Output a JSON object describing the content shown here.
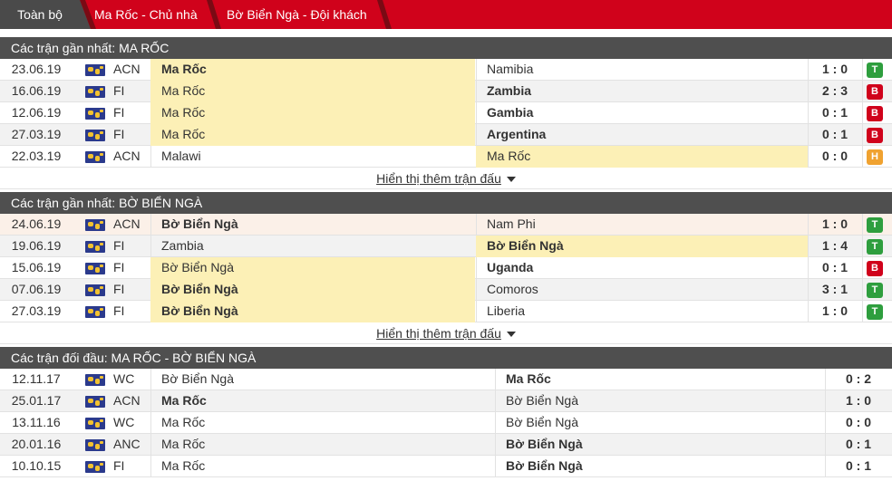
{
  "tabs": [
    {
      "label": "Toàn bộ",
      "active": true
    },
    {
      "label": "Ma Rốc - Chủ nhà",
      "active": false
    },
    {
      "label": "Bờ Biển Ngà - Đội khách",
      "active": false
    }
  ],
  "colors": {
    "tab_bar": "#d0021b",
    "header": "#4f4f4f",
    "win": "#2e9e3e",
    "loss": "#d0021b",
    "draw": "#f0a230",
    "highlight": "#fcf0b6"
  },
  "sections": [
    {
      "title": "Các trận gần nhất: MA RỐC",
      "more": "Hiển thị thêm trận đấu",
      "rows": [
        {
          "date": "23.06.19",
          "comp": "ACN",
          "home": "Ma Rốc",
          "away": "Namibia",
          "score": "1 : 0",
          "result": "T",
          "home_bold": true,
          "away_bold": false,
          "home_hl": true,
          "away_hl": false,
          "row_hl": false
        },
        {
          "date": "16.06.19",
          "comp": "FI",
          "home": "Ma Rốc",
          "away": "Zambia",
          "score": "2 : 3",
          "result": "B",
          "home_bold": false,
          "away_bold": true,
          "home_hl": true,
          "away_hl": false,
          "row_hl": false
        },
        {
          "date": "12.06.19",
          "comp": "FI",
          "home": "Ma Rốc",
          "away": "Gambia",
          "score": "0 : 1",
          "result": "B",
          "home_bold": false,
          "away_bold": true,
          "home_hl": true,
          "away_hl": false,
          "row_hl": false
        },
        {
          "date": "27.03.19",
          "comp": "FI",
          "home": "Ma Rốc",
          "away": "Argentina",
          "score": "0 : 1",
          "result": "B",
          "home_bold": false,
          "away_bold": true,
          "home_hl": true,
          "away_hl": false,
          "row_hl": false
        },
        {
          "date": "22.03.19",
          "comp": "ACN",
          "home": "Malawi",
          "away": "Ma Rốc",
          "score": "0 : 0",
          "result": "H",
          "home_bold": false,
          "away_bold": false,
          "home_hl": false,
          "away_hl": true,
          "row_hl": false
        }
      ]
    },
    {
      "title": "Các trận gần nhất: BỜ BIỂN NGÀ",
      "more": "Hiển thị thêm trận đấu",
      "rows": [
        {
          "date": "24.06.19",
          "comp": "ACN",
          "home": "Bờ Biển Ngà",
          "away": "Nam Phi",
          "score": "1 : 0",
          "result": "T",
          "home_bold": true,
          "away_bold": false,
          "home_hl": false,
          "away_hl": false,
          "row_hl": true
        },
        {
          "date": "19.06.19",
          "comp": "FI",
          "home": "Zambia",
          "away": "Bờ Biển Ngà",
          "score": "1 : 4",
          "result": "T",
          "home_bold": false,
          "away_bold": true,
          "home_hl": false,
          "away_hl": true,
          "row_hl": false
        },
        {
          "date": "15.06.19",
          "comp": "FI",
          "home": "Bờ Biển Ngà",
          "away": "Uganda",
          "score": "0 : 1",
          "result": "B",
          "home_bold": false,
          "away_bold": true,
          "home_hl": true,
          "away_hl": false,
          "row_hl": false
        },
        {
          "date": "07.06.19",
          "comp": "FI",
          "home": "Bờ Biển Ngà",
          "away": "Comoros",
          "score": "3 : 1",
          "result": "T",
          "home_bold": true,
          "away_bold": false,
          "home_hl": true,
          "away_hl": false,
          "row_hl": false
        },
        {
          "date": "27.03.19",
          "comp": "FI",
          "home": "Bờ Biển Ngà",
          "away": "Liberia",
          "score": "1 : 0",
          "result": "T",
          "home_bold": true,
          "away_bold": false,
          "home_hl": true,
          "away_hl": false,
          "row_hl": false
        }
      ]
    },
    {
      "title": "Các trận đối đầu: MA RỐC - BỜ BIỂN NGÀ",
      "rows": [
        {
          "date": "12.11.17",
          "comp": "WC",
          "home": "Bờ Biển Ngà",
          "away": "Ma Rốc",
          "score": "0 : 2",
          "home_bold": false,
          "away_bold": true
        },
        {
          "date": "25.01.17",
          "comp": "ACN",
          "home": "Ma Rốc",
          "away": "Bờ Biển Ngà",
          "score": "1 : 0",
          "home_bold": true,
          "away_bold": false
        },
        {
          "date": "13.11.16",
          "comp": "WC",
          "home": "Ma Rốc",
          "away": "Bờ Biển Ngà",
          "score": "0 : 0",
          "home_bold": false,
          "away_bold": false
        },
        {
          "date": "20.01.16",
          "comp": "ANC",
          "home": "Ma Rốc",
          "away": "Bờ Biển Ngà",
          "score": "0 : 1",
          "home_bold": false,
          "away_bold": true
        },
        {
          "date": "10.10.15",
          "comp": "FI",
          "home": "Ma Rốc",
          "away": "Bờ Biển Ngà",
          "score": "0 : 1",
          "home_bold": false,
          "away_bold": true
        }
      ]
    }
  ]
}
